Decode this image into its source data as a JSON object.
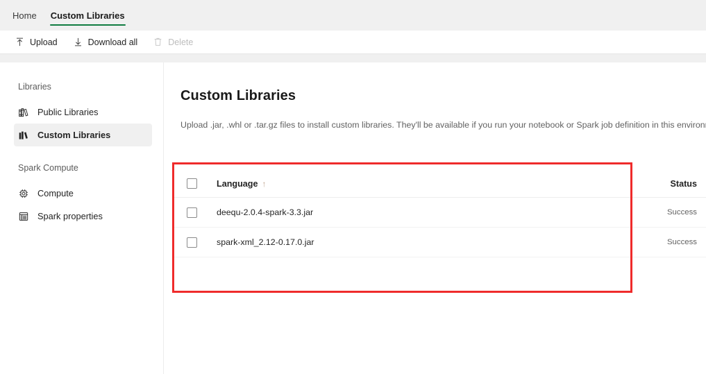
{
  "tabs": [
    {
      "label": "Home",
      "active": false
    },
    {
      "label": "Custom Libraries",
      "active": true
    }
  ],
  "toolbar": {
    "upload_label": "Upload",
    "download_all_label": "Download all",
    "delete_label": "Delete"
  },
  "sidebar": {
    "section_libraries": "Libraries",
    "section_spark_compute": "Spark Compute",
    "items": [
      {
        "label": "Public Libraries",
        "icon": "books-outline-icon",
        "selected": false
      },
      {
        "label": "Custom Libraries",
        "icon": "books-filled-icon",
        "selected": true
      },
      {
        "label": "Compute",
        "icon": "cpu-chip-icon",
        "selected": false
      },
      {
        "label": "Spark properties",
        "icon": "list-table-icon",
        "selected": false
      }
    ]
  },
  "main": {
    "title": "Custom Libraries",
    "description": "Upload .jar, .whl or .tar.gz files to install custom libraries. They'll be available if you run your notebook or Spark job definition in this environment",
    "table": {
      "columns": {
        "language": "Language",
        "status": "Status"
      },
      "sort_indicator": "↑",
      "rows": [
        {
          "name": "deequ-2.0.4-spark-3.3.jar",
          "status": "Success"
        },
        {
          "name": "spark-xml_2.12-0.17.0.jar",
          "status": "Success"
        }
      ]
    }
  },
  "annotation": {
    "highlight_color": "#ef2b2b"
  },
  "colors": {
    "tab_accent": "#107c41",
    "chrome_gray": "#f0f0f0",
    "text_primary": "#242424",
    "text_secondary": "#616161"
  }
}
